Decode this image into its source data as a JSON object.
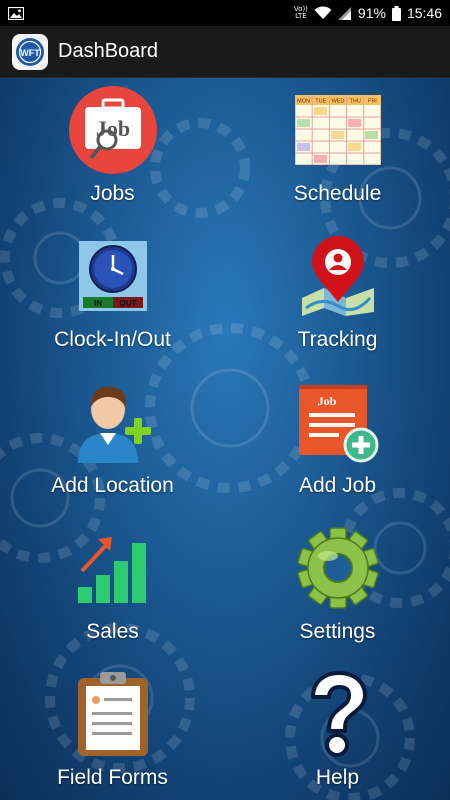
{
  "status_bar": {
    "volte_top": "Vo))",
    "volte_bottom": "LTE",
    "battery": "91%",
    "time": "15:46"
  },
  "app_bar": {
    "logo_text": "WFT",
    "title": "DashBoard"
  },
  "tiles": [
    {
      "label": "Jobs",
      "icon": "jobs-briefcase-icon"
    },
    {
      "label": "Schedule",
      "icon": "schedule-calendar-icon"
    },
    {
      "label": "Clock-In/Out",
      "icon": "clock-icon"
    },
    {
      "label": "Tracking",
      "icon": "map-pin-icon"
    },
    {
      "label": "Add Location",
      "icon": "add-person-icon"
    },
    {
      "label": "Add Job",
      "icon": "add-job-icon"
    },
    {
      "label": "Sales",
      "icon": "sales-chart-icon"
    },
    {
      "label": "Settings",
      "icon": "gear-icon"
    },
    {
      "label": "Field Forms",
      "icon": "clipboard-icon"
    },
    {
      "label": "Help",
      "icon": "question-mark-icon"
    }
  ],
  "icon_text": {
    "jobs_word": "Job",
    "schedule_days": [
      "MON",
      "TUE",
      "WED",
      "THU",
      "FRI"
    ],
    "clock_in": "IN",
    "clock_out": "OUT",
    "add_job_word": "Job"
  },
  "colors": {
    "background": "#1d5e98",
    "jobs_red": "#e8453c",
    "tracking_red": "#d0121b",
    "sales_green": "#2ecc71",
    "settings_green": "#8bc34a",
    "add_job_orange": "#e8562a"
  }
}
